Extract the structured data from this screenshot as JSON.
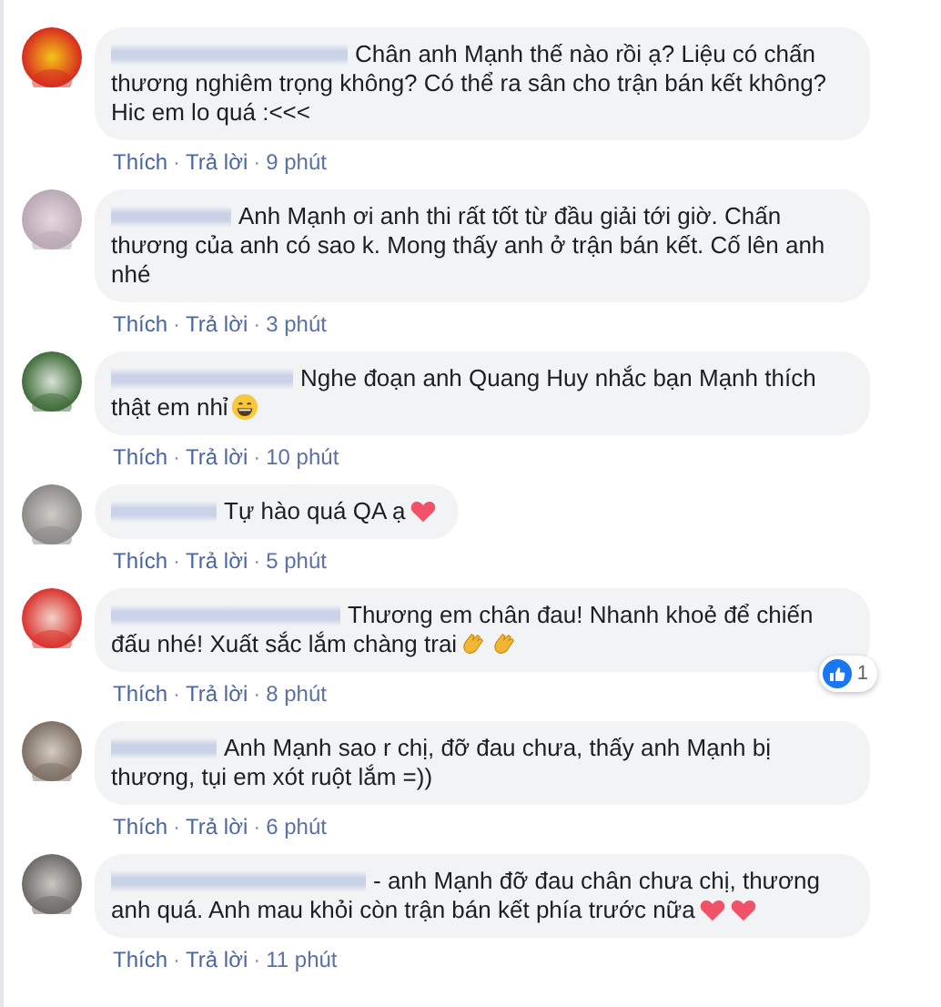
{
  "comments": [
    {
      "text": "Chân anh Mạnh thế nào rồi ạ? Liệu có chấn thương nghiêm trọng không? Có thể ra sân cho trận bán kết không? Hic em lo quá :<<<",
      "actions": [
        {
          "kind": "like",
          "label": "Thích"
        },
        {
          "kind": "sep",
          "label": "·"
        },
        {
          "kind": "reply",
          "label": "Trả lời"
        },
        {
          "kind": "sep",
          "label": "·"
        },
        {
          "kind": "time",
          "label": "9 phút"
        }
      ]
    },
    {
      "text": "Anh Mạnh ơi anh thi rất tốt từ đầu giải tới giờ. Chấn thương của anh có sao k. Mong thấy anh ở trận bán kết. Cố lên anh nhé",
      "actions": [
        {
          "kind": "like",
          "label": "Thích"
        },
        {
          "kind": "sep",
          "label": "·"
        },
        {
          "kind": "reply",
          "label": "Trả lời"
        },
        {
          "kind": "sep",
          "label": "·"
        },
        {
          "kind": "time",
          "label": "3 phút"
        }
      ]
    },
    {
      "text": "Nghe đoạn anh Quang Huy nhắc bạn Mạnh thích thật em nhỉ",
      "emoji_icons": [
        {
          "kind": "grin"
        }
      ],
      "actions": [
        {
          "kind": "like",
          "label": "Thích"
        },
        {
          "kind": "sep",
          "label": "·"
        },
        {
          "kind": "reply",
          "label": "Trả lời"
        },
        {
          "kind": "sep",
          "label": "·"
        },
        {
          "kind": "time",
          "label": "10 phút"
        }
      ]
    },
    {
      "text": "Tự hào quá QA ạ",
      "emoji_icons": [
        {
          "kind": "heart"
        }
      ],
      "actions": [
        {
          "kind": "like",
          "label": "Thích"
        },
        {
          "kind": "sep",
          "label": "·"
        },
        {
          "kind": "reply",
          "label": "Trả lời"
        },
        {
          "kind": "sep",
          "label": "·"
        },
        {
          "kind": "time",
          "label": "5 phút"
        }
      ]
    },
    {
      "text": "Thương em chân đau! Nhanh khoẻ để chiến đấu nhé! Xuất sắc lắm chàng trai",
      "emoji_icons": [
        {
          "kind": "clap"
        },
        {
          "kind": "clap"
        }
      ],
      "actions": [
        {
          "kind": "like",
          "label": "Thích"
        },
        {
          "kind": "sep",
          "label": "·"
        },
        {
          "kind": "reply",
          "label": "Trả lời"
        },
        {
          "kind": "sep",
          "label": "·"
        },
        {
          "kind": "time",
          "label": "8 phút"
        }
      ],
      "likes": "1"
    },
    {
      "text": "Anh Mạnh sao r chị, đỡ đau chưa, thấy anh Mạnh bị thương, tụi em xót ruột lắm =))",
      "actions": [
        {
          "kind": "like",
          "label": "Thích"
        },
        {
          "kind": "sep",
          "label": "·"
        },
        {
          "kind": "reply",
          "label": "Trả lời"
        },
        {
          "kind": "sep",
          "label": "·"
        },
        {
          "kind": "time",
          "label": "6 phút"
        }
      ]
    },
    {
      "text": "- anh Mạnh đỡ đau chân chưa chị, thương anh quá. Anh mau khỏi còn trận bán kết phía trước nữa",
      "emoji_icons": [
        {
          "kind": "heart"
        },
        {
          "kind": "heart"
        }
      ],
      "actions": [
        {
          "kind": "like",
          "label": "Thích"
        },
        {
          "kind": "sep",
          "label": "·"
        },
        {
          "kind": "reply",
          "label": "Trả lời"
        },
        {
          "kind": "sep",
          "label": "·"
        },
        {
          "kind": "time",
          "label": "11 phút"
        }
      ]
    }
  ]
}
